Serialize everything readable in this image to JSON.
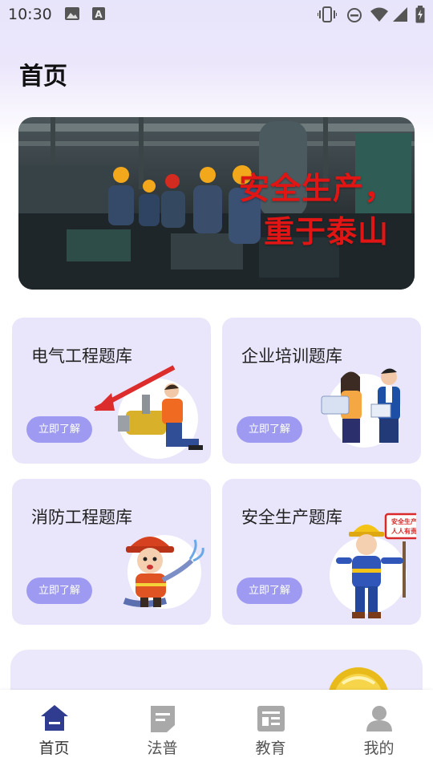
{
  "status_bar": {
    "time": "10:30",
    "icons": [
      "image-icon",
      "a-icon",
      "vibrate-icon",
      "dnd-icon",
      "wifi-icon",
      "signal-icon",
      "battery-icon"
    ]
  },
  "page_title": "首页",
  "banner": {
    "line1": "安全生产，",
    "line2": "重于泰山"
  },
  "cards": [
    {
      "title": "电气工程题库",
      "button": "立即了解"
    },
    {
      "title": "企业培训题库",
      "button": "立即了解"
    },
    {
      "title": "消防工程题库",
      "button": "立即了解"
    },
    {
      "title": "安全生产题库",
      "button": "立即了解"
    }
  ],
  "sign_text": {
    "line1": "安全生产",
    "line2": "人人有责"
  },
  "nav": {
    "items": [
      {
        "label": "首页",
        "icon": "home-icon",
        "active": true
      },
      {
        "label": "法普",
        "icon": "document-icon",
        "active": false
      },
      {
        "label": "教育",
        "icon": "news-icon",
        "active": false
      },
      {
        "label": "我的",
        "icon": "person-icon",
        "active": false
      }
    ]
  },
  "colors": {
    "accent": "#2f3c8f",
    "card_bg": "#e9e6fb",
    "button_bg": "#9e9af1",
    "banner_text": "#e21515"
  }
}
